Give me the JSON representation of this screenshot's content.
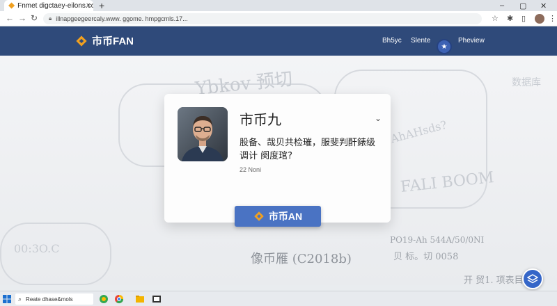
{
  "browser": {
    "tab_title": "Fnmet digctaey-eilons.com",
    "tab_close": "×",
    "new_tab": "+",
    "win_minimize": "–",
    "win_maximize": "▢",
    "win_close": "✕",
    "back": "←",
    "forward": "→",
    "reload": "↻",
    "url": "illnapgeegeercaly.www. ggome. hmpgcmls.17...",
    "toolbar_icons": [
      "star-icon",
      "extensions-icon",
      "sidepanel-icon",
      "profile-avatar",
      "menu-icon"
    ]
  },
  "site_nav": {
    "brand": "市币FAN",
    "links": [
      "Bh5yc",
      "Slente"
    ],
    "preview": "Pheview"
  },
  "background_text": [
    "Ybkov 预切",
    "数据库",
    "AhAHsds?",
    "FALI BOOM",
    "00:3O.C",
    "PO19-Ah 544A/50/0NI",
    "像币雁 (C2018b)",
    "贝 标。切 0058",
    "开 贸1. 项表目"
  ],
  "card": {
    "name": "市币九",
    "description": "股备、哉贝共检璀，服斐判酐錶级调计 阕度琯?",
    "meta": "22 Noni",
    "chevron": "⌄"
  },
  "cta_label": "市币AN",
  "taskbar": {
    "search_text": "Reate dhase&mols",
    "clock_time": "",
    "clock_date": ""
  },
  "colors": {
    "nav": "#2f4a7a",
    "cta": "#4a73c3",
    "brand_logo": "#f0a020"
  }
}
